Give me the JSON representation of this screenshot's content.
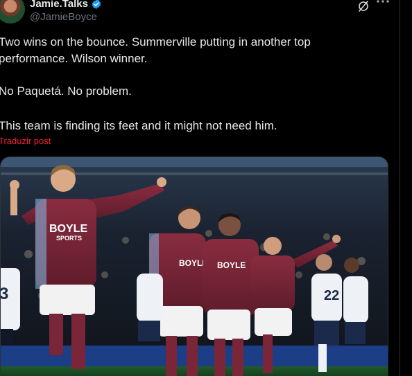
{
  "author": {
    "display_name": "Jamie.Talks",
    "handle": "@JamieBoyce",
    "verified": true
  },
  "actions": {
    "grok_icon": "grok-icon",
    "more_icon": "more-horizontal-icon"
  },
  "post": {
    "line1": "Two wins on the bounce. Summerville putting in another top",
    "line2": "performance. Wilson winner.",
    "line3": "No Paquetá. No problem.",
    "line4": "This team is finding its feet and it might not need him.",
    "translate_label": "Traduzir post"
  },
  "media": {
    "sponsor_text": "BOYLE",
    "sponsor_sub": "SPORTS",
    "away_numbers": [
      "3",
      "22"
    ]
  },
  "colors": {
    "background": "#000000",
    "text": "#e7e9ea",
    "muted": "#71767b",
    "verified": "#1d9bf0",
    "translate": "#f4212e",
    "claret": "#7a2638"
  }
}
